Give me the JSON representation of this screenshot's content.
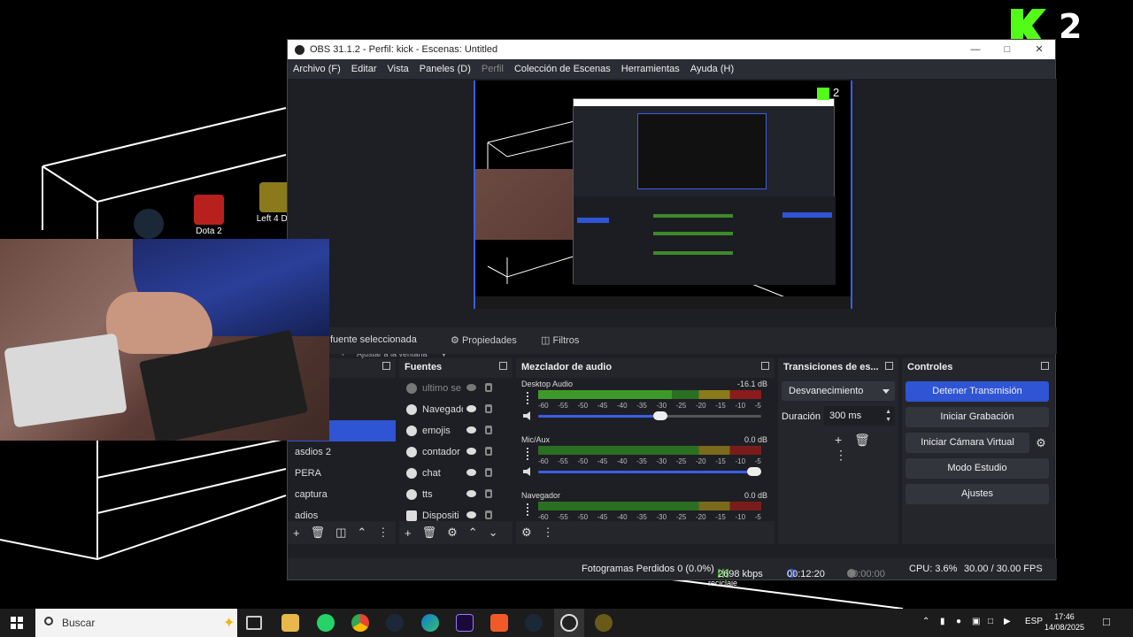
{
  "desktop": {
    "icons": [
      {
        "label": ""
      },
      {
        "label": "Dota 2"
      },
      {
        "label": "Left 4 De"
      }
    ],
    "overlay_badge": "2",
    "recycle_label": "reciclaje"
  },
  "obs": {
    "title": "OBS 31.1.2 - Perfil: kick - Escenas: Untitled",
    "menu": [
      "Archivo (F)",
      "Editar",
      "Vista",
      "Paneles (D)",
      "Perfil",
      "Colección de Escenas",
      "Herramientas",
      "Ayuda (H)"
    ],
    "preview_badge": "2",
    "preview_toolbar": {
      "fit_label": "Ajustar a la ventana"
    },
    "source_bar": {
      "no_selection": "fuente seleccionada",
      "properties": "Propiedades",
      "filters": "Filtros"
    },
    "scenes": {
      "items": [
        "",
        "",
        "",
        "asdios 2",
        "PERA",
        "captura",
        "adios"
      ],
      "selected_index": 2
    },
    "sources": {
      "title": "Fuentes",
      "items": [
        {
          "name": "ultimo se",
          "type": "globe",
          "dim": true
        },
        {
          "name": "Navegado",
          "type": "globe",
          "dim": false
        },
        {
          "name": "emojis",
          "type": "globe",
          "dim": false
        },
        {
          "name": "contador",
          "type": "globe",
          "dim": false
        },
        {
          "name": "chat",
          "type": "globe",
          "dim": false
        },
        {
          "name": "tts",
          "type": "globe",
          "dim": false
        },
        {
          "name": "Dispositi",
          "type": "camera",
          "dim": false
        }
      ]
    },
    "mixer": {
      "title": "Mezclador de audio",
      "ticks": [
        "-60",
        "-55",
        "-50",
        "-45",
        "-40",
        "-35",
        "-30",
        "-25",
        "-20",
        "-15",
        "-10",
        "-5"
      ],
      "channels": [
        {
          "name": "Desktop Audio",
          "db": "-16.1 dB",
          "volume": 0.55
        },
        {
          "name": "Mic/Aux",
          "db": "0.0 dB",
          "volume": 1.0
        },
        {
          "name": "Navegador",
          "db": "0.0 dB",
          "volume": 1.0
        }
      ]
    },
    "transitions": {
      "title": "Transiciones de es...",
      "selected": "Desvanecimiento",
      "duration_label": "Duración",
      "duration_value": "300 ms"
    },
    "controls": {
      "title": "Controles",
      "stop_stream": "Detener Transmisión",
      "start_recording": "Iniciar Grabación",
      "start_virtual_cam": "Iniciar Cámara Virtual",
      "studio_mode": "Modo Estudio",
      "settings": "Ajustes"
    },
    "status": {
      "dropped_frames": "Fotogramas Perdidos 0 (0.0%)",
      "bitrate": "2698 kbps",
      "stream_time": "00:12:20",
      "rec_time": "00:00:00",
      "cpu": "CPU: 3.6%",
      "fps": "30.00 / 30.00 FPS"
    }
  },
  "taskbar": {
    "search_placeholder": "Buscar",
    "language": "ESP",
    "time": "17:46",
    "date": "14/08/2025"
  },
  "colors": {
    "accent": "#2f55d4",
    "kick_green": "#53fc18",
    "meter_green": "#3d9a2a"
  }
}
